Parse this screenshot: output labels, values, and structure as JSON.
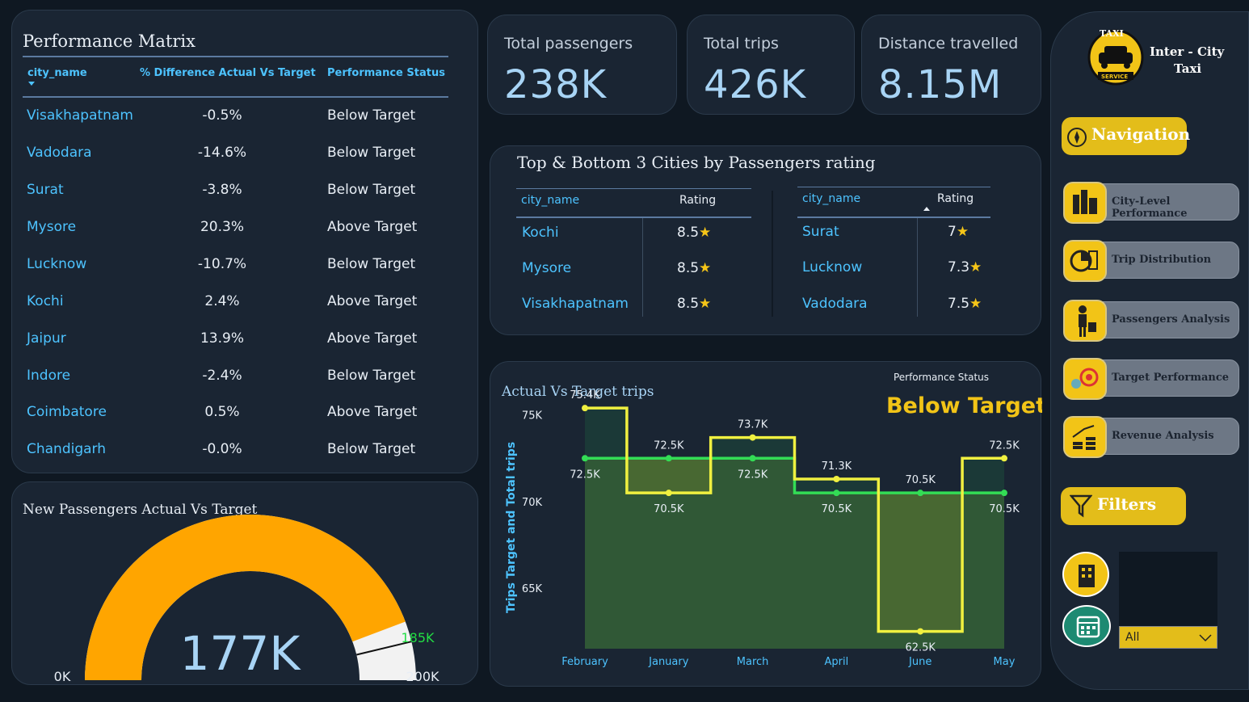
{
  "performance_matrix": {
    "title": "Performance Matrix",
    "columns": [
      "city_name",
      "% Difference Actual Vs Target",
      "Performance Status"
    ],
    "rows": [
      {
        "city": "Visakhapatnam",
        "diff": "-0.5%",
        "status": "Below Target"
      },
      {
        "city": "Vadodara",
        "diff": "-14.6%",
        "status": "Below Target"
      },
      {
        "city": "Surat",
        "diff": "-3.8%",
        "status": "Below Target"
      },
      {
        "city": "Mysore",
        "diff": "20.3%",
        "status": "Above Target"
      },
      {
        "city": "Lucknow",
        "diff": "-10.7%",
        "status": "Below Target"
      },
      {
        "city": "Kochi",
        "diff": "2.4%",
        "status": "Above Target"
      },
      {
        "city": "Jaipur",
        "diff": "13.9%",
        "status": "Above Target"
      },
      {
        "city": "Indore",
        "diff": "-2.4%",
        "status": "Below Target"
      },
      {
        "city": "Coimbatore",
        "diff": "0.5%",
        "status": "Above Target"
      },
      {
        "city": "Chandigarh",
        "diff": "-0.0%",
        "status": "Below Target"
      }
    ]
  },
  "kpis": {
    "passengers": {
      "label": "Total passengers",
      "value": "238K"
    },
    "trips": {
      "label": "Total trips",
      "value": "426K"
    },
    "distance": {
      "label": "Distance travelled",
      "value": "8.15M"
    }
  },
  "rating": {
    "title": "Top & Bottom 3 Cities by Passengers rating",
    "col_city": "city_name",
    "col_rating": "Rating",
    "top": [
      {
        "city": "Kochi",
        "rating": "8.5"
      },
      {
        "city": "Mysore",
        "rating": "8.5"
      },
      {
        "city": "Visakhapatnam",
        "rating": "8.5"
      }
    ],
    "bottom": [
      {
        "city": "Surat",
        "rating": "7"
      },
      {
        "city": "Lucknow",
        "rating": "7.3"
      },
      {
        "city": "Vadodara",
        "rating": "7.5"
      }
    ],
    "star": "★"
  },
  "gauge": {
    "title": "New Passengers Actual Vs Target",
    "value_label": "177K",
    "min_label": "0K",
    "max_label": "200K",
    "target_label": "185K",
    "value": 177,
    "target": 185,
    "max": 200,
    "colors": {
      "fill": "#ffa500",
      "track": "#f2f2f2",
      "target": "#22dd44"
    }
  },
  "chart_title": "Actual Vs Target trips",
  "status_caption": "Performance Status",
  "status_value": "Below Target",
  "chart_data": {
    "type": "line",
    "categories": [
      "February",
      "January",
      "March",
      "April",
      "June",
      "May"
    ],
    "series": [
      {
        "name": "Trips Target",
        "values": [
          72.5,
          72.5,
          72.5,
          70.5,
          70.5,
          70.5
        ],
        "labels": [
          "72.5K",
          "72.5K",
          "72.5K",
          "70.5K",
          "70.5K",
          "70.5K"
        ],
        "color": "#33dd55"
      },
      {
        "name": "Total trips",
        "values": [
          75.4,
          70.5,
          73.7,
          71.3,
          62.5,
          72.5
        ],
        "labels": [
          "75.4K",
          "70.5K",
          "73.7K",
          "71.3K",
          "62.5K",
          "72.5K"
        ],
        "color": "#f0f040"
      }
    ],
    "ylabel": "Trips Target and Total trips",
    "yticks": [
      "75K",
      "70K",
      "65K"
    ],
    "ytick_values": [
      75,
      70,
      65
    ],
    "ylim": [
      61.5,
      75.5
    ]
  },
  "sidebar": {
    "brand_line1": "Inter - City",
    "brand_line2": "Taxi",
    "logo_top": "TAXI",
    "logo_bottom": "SERVICE",
    "navigation": "Navigation",
    "nav_items": [
      "City-Level Performance",
      "Trip Distribution",
      "Passengers Analysis",
      "Target Performance",
      "Revenue Analysis"
    ],
    "filters": "Filters",
    "filter_value": "All"
  }
}
